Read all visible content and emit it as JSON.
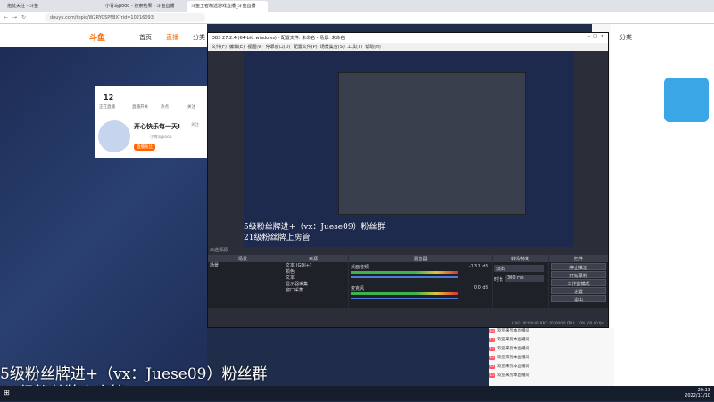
{
  "browser": {
    "tabs": [
      {
        "label": "抱枕关注 - 斗鱼"
      },
      {
        "label": "小青岛pooo - 搜索结果 - 斗鱼直播"
      },
      {
        "label": "斗鱼王者精选游戏直播_斗鱼直播"
      }
    ],
    "url": "douyu.com/topic/W2RYCSPFBX?rid=10216093"
  },
  "site": {
    "logo": "斗鱼",
    "nav": [
      "首页",
      "直播",
      "分类"
    ],
    "right_nav": "分类"
  },
  "card": {
    "stats": [
      {
        "value": "12",
        "label": "正在直播"
      },
      {
        "value": "",
        "label": "直播开关"
      },
      {
        "value": "",
        "label": "热点"
      },
      {
        "value": "",
        "label": "关注"
      }
    ],
    "streamer_title": "开心快乐每一天!",
    "streamer_name": "小青岛pooo",
    "button": "直播粉丝",
    "follow": "关注"
  },
  "obs": {
    "title": "OBS 27.2.4 (64-bit, windows) - 配置文件: 未命名 - 场景: 未命名",
    "menu": [
      "文件(F)",
      "编辑(E)",
      "视图(V)",
      "停靠窗口(D)",
      "配置文件(P)",
      "场景集合(S)",
      "工具(T)",
      "帮助(H)"
    ],
    "no_source": "未选择源",
    "docks": {
      "scenes": "场景",
      "sources": "来源",
      "mixer": "混音器",
      "transitions": "转场特效",
      "controls": "控件"
    },
    "scene_item": "场景",
    "sources": [
      "文本 (GDI+)",
      "颜色",
      "文本",
      "显示器采集",
      "窗口采集"
    ],
    "mixer": [
      {
        "name": "桌面音频",
        "db": "-13.1 dB"
      },
      {
        "name": "麦克风",
        "db": "0.0 dB"
      }
    ],
    "transition_type": "淡出",
    "transition_duration_label": "时长",
    "transition_duration": "300 ms",
    "controls": [
      "停止推流",
      "开始录制",
      "工作室模式",
      "设置",
      "退出"
    ],
    "status": "LIVE: 00:00:00   REC: 00:00:00   CPU: 1.0%, 60.00 fps"
  },
  "overlay": {
    "line1": "5级粉丝牌进+（vx：Juese09）粉丝群",
    "line2": "21级粉丝牌上房管"
  },
  "chat": [
    {
      "text": "欢迎来到本直播间"
    },
    {
      "text": "欢迎来到本直播间"
    },
    {
      "text": "欢迎来到本直播间"
    },
    {
      "text": "欢迎来到本直播间"
    },
    {
      "text": "欢迎来到本直播间"
    },
    {
      "text": "欢迎来到本直播间"
    }
  ],
  "taskbar": {
    "time": "20:13",
    "date": "2022/11/10"
  }
}
